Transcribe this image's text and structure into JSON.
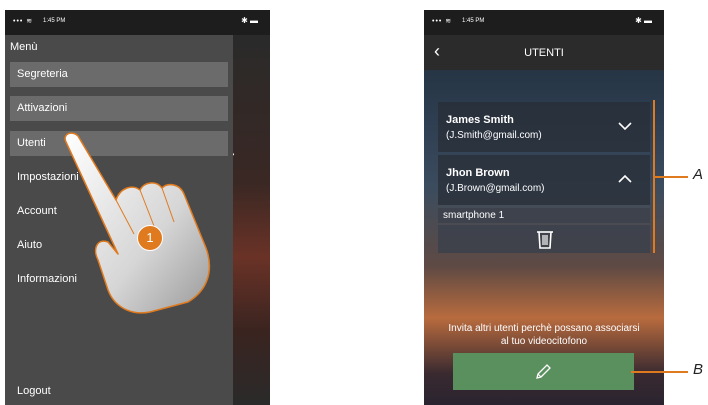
{
  "status_bar": {
    "time": "1:45 PM"
  },
  "left_menu": {
    "title": "Menù",
    "items": [
      {
        "label": "Segreteria"
      },
      {
        "label": "Attivazioni"
      },
      {
        "label": "Utenti"
      },
      {
        "label": "Impostazioni"
      },
      {
        "label": "Account"
      },
      {
        "label": "Aiuto"
      },
      {
        "label": "Informazioni"
      }
    ],
    "logout": "Logout",
    "step_number": "1"
  },
  "users_screen": {
    "title": "UTENTI",
    "users": [
      {
        "name": "James Smith",
        "email": "(J.Smith@gmail.com)",
        "expanded": false
      },
      {
        "name": "Jhon Brown",
        "email": "(J.Brown@gmail.com)",
        "expanded": true
      }
    ],
    "device": "smartphone 1",
    "invite_text_line1": "Invita altri utenti perchè possano associarsi",
    "invite_text_line2": "al tuo videocitofono"
  },
  "callouts": {
    "a": "A",
    "b": "B"
  },
  "colors": {
    "accent": "#e07a1f",
    "button_green": "#5a8f5e",
    "menu_bg": "#4a4a4a",
    "menu_highlight": "#6b6b6b"
  },
  "icons": [
    "back-chevron-icon",
    "chevron-down-icon",
    "chevron-up-icon",
    "trash-icon",
    "pencil-icon",
    "wifi-icon",
    "bluetooth-icon",
    "battery-icon"
  ]
}
